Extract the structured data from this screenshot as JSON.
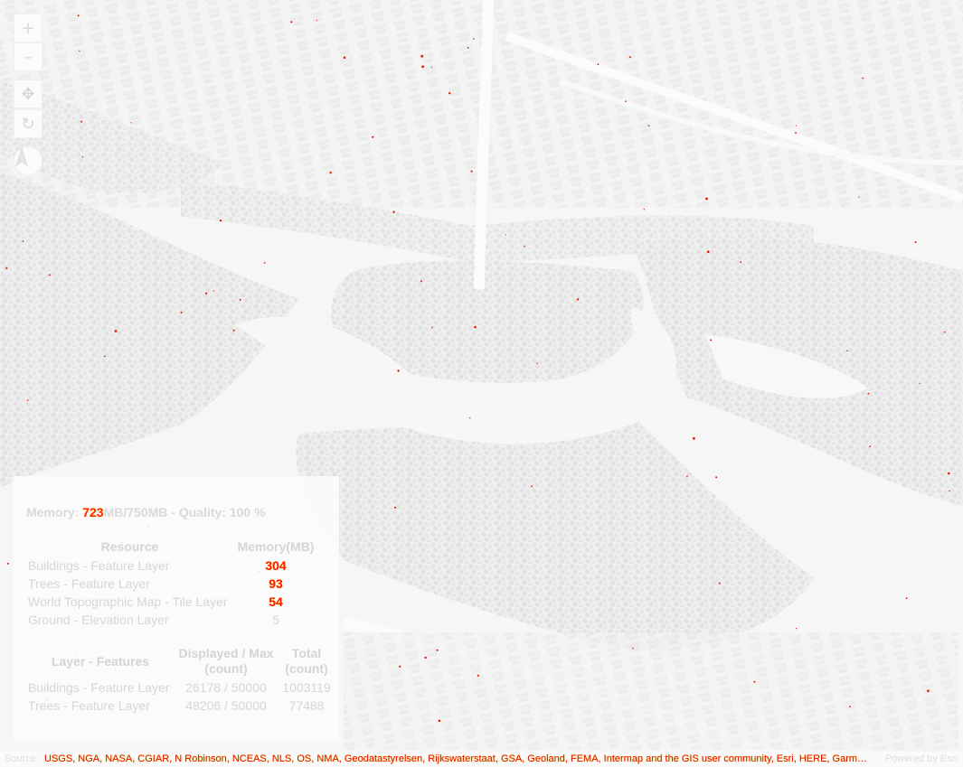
{
  "map": {
    "description_style": "light-gray 3D city scene",
    "colors": {
      "background": "#f6f6f6",
      "tree": "#e4e4e4",
      "building": "#ececec",
      "road": "#fbfbfb",
      "hotspot": "#e61a00"
    }
  },
  "navigation": {
    "zoom_in_icon": "plus-icon",
    "zoom_out_icon": "minus-icon",
    "pan_icon": "move-arrows-icon",
    "rotate_icon": "rotate-icon",
    "compass_icon": "compass-icon",
    "zoom_in_glyph": "+",
    "zoom_out_glyph": "–",
    "pan_glyph": "✥",
    "rotate_glyph": "↻"
  },
  "performance": {
    "memory_prefix": "Memory: ",
    "memory_used": "723",
    "memory_suffix": "MB/750MB - Quality: 100 %",
    "resources": {
      "headers": [
        "Resource",
        "Memory(MB)"
      ],
      "rows": [
        {
          "name": "Buildings - Feature Layer",
          "memory": "304"
        },
        {
          "name": "Trees - Feature Layer",
          "memory": "93"
        },
        {
          "name": "World Topographic Map - Tile Layer",
          "memory": "54"
        },
        {
          "name": "Ground - Elevation Layer",
          "memory": "5"
        }
      ]
    },
    "features": {
      "headers": [
        "Layer - Features",
        "Displayed / Max\n(count)",
        "Total\n(count)"
      ],
      "rows": [
        {
          "name": "Buildings - Feature Layer",
          "displayed": "26178 / 50000",
          "total": "1003119"
        },
        {
          "name": "Trees - Feature Layer",
          "displayed": "48206 / 50000",
          "total": "77488"
        }
      ]
    }
  },
  "attribution": {
    "label": "Source:",
    "text": "USGS, NGA, NASA, CGIAR, N Robinson, NCEAS, NLS, OS, NMA, Geodatastyrelsen, Rijkswaterstaat, GSA, Geoland, FEMA, Intermap and the GIS user community, Esri, HERE, Garmin, NGA, USGS, Esri Community Maps contributors",
    "powered": "Powered by Esri"
  }
}
